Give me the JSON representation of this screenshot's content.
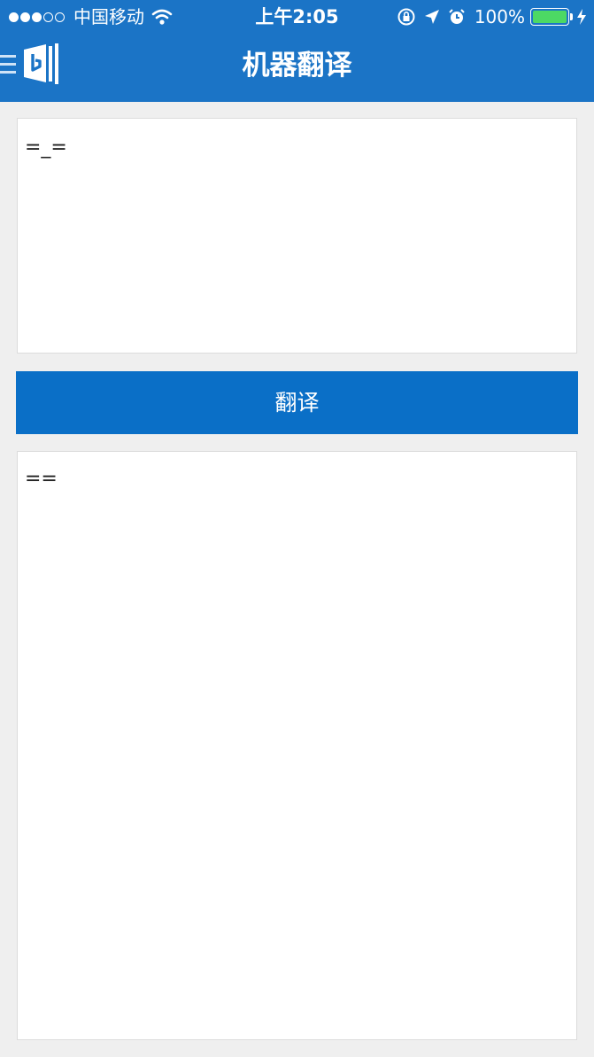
{
  "status_bar": {
    "signal_filled": 3,
    "signal_total": 5,
    "carrier": "中国移动",
    "time": "上午2:05",
    "battery_percent": "100%",
    "battery_level": 1.0,
    "battery_color": "#4cd964",
    "icons": [
      "wifi-icon",
      "orientation-lock-icon",
      "location-icon",
      "alarm-icon",
      "charging-bolt-icon"
    ]
  },
  "header": {
    "title": "机器翻译",
    "menu_icon": "hamburger-icon",
    "logo_icon": "bing-dictionary-logo-icon",
    "background_color": "#1b74c6"
  },
  "translator": {
    "source_text": "=_=",
    "translate_label": "翻译",
    "button_color": "#0a6fc7",
    "result_text": "=="
  }
}
